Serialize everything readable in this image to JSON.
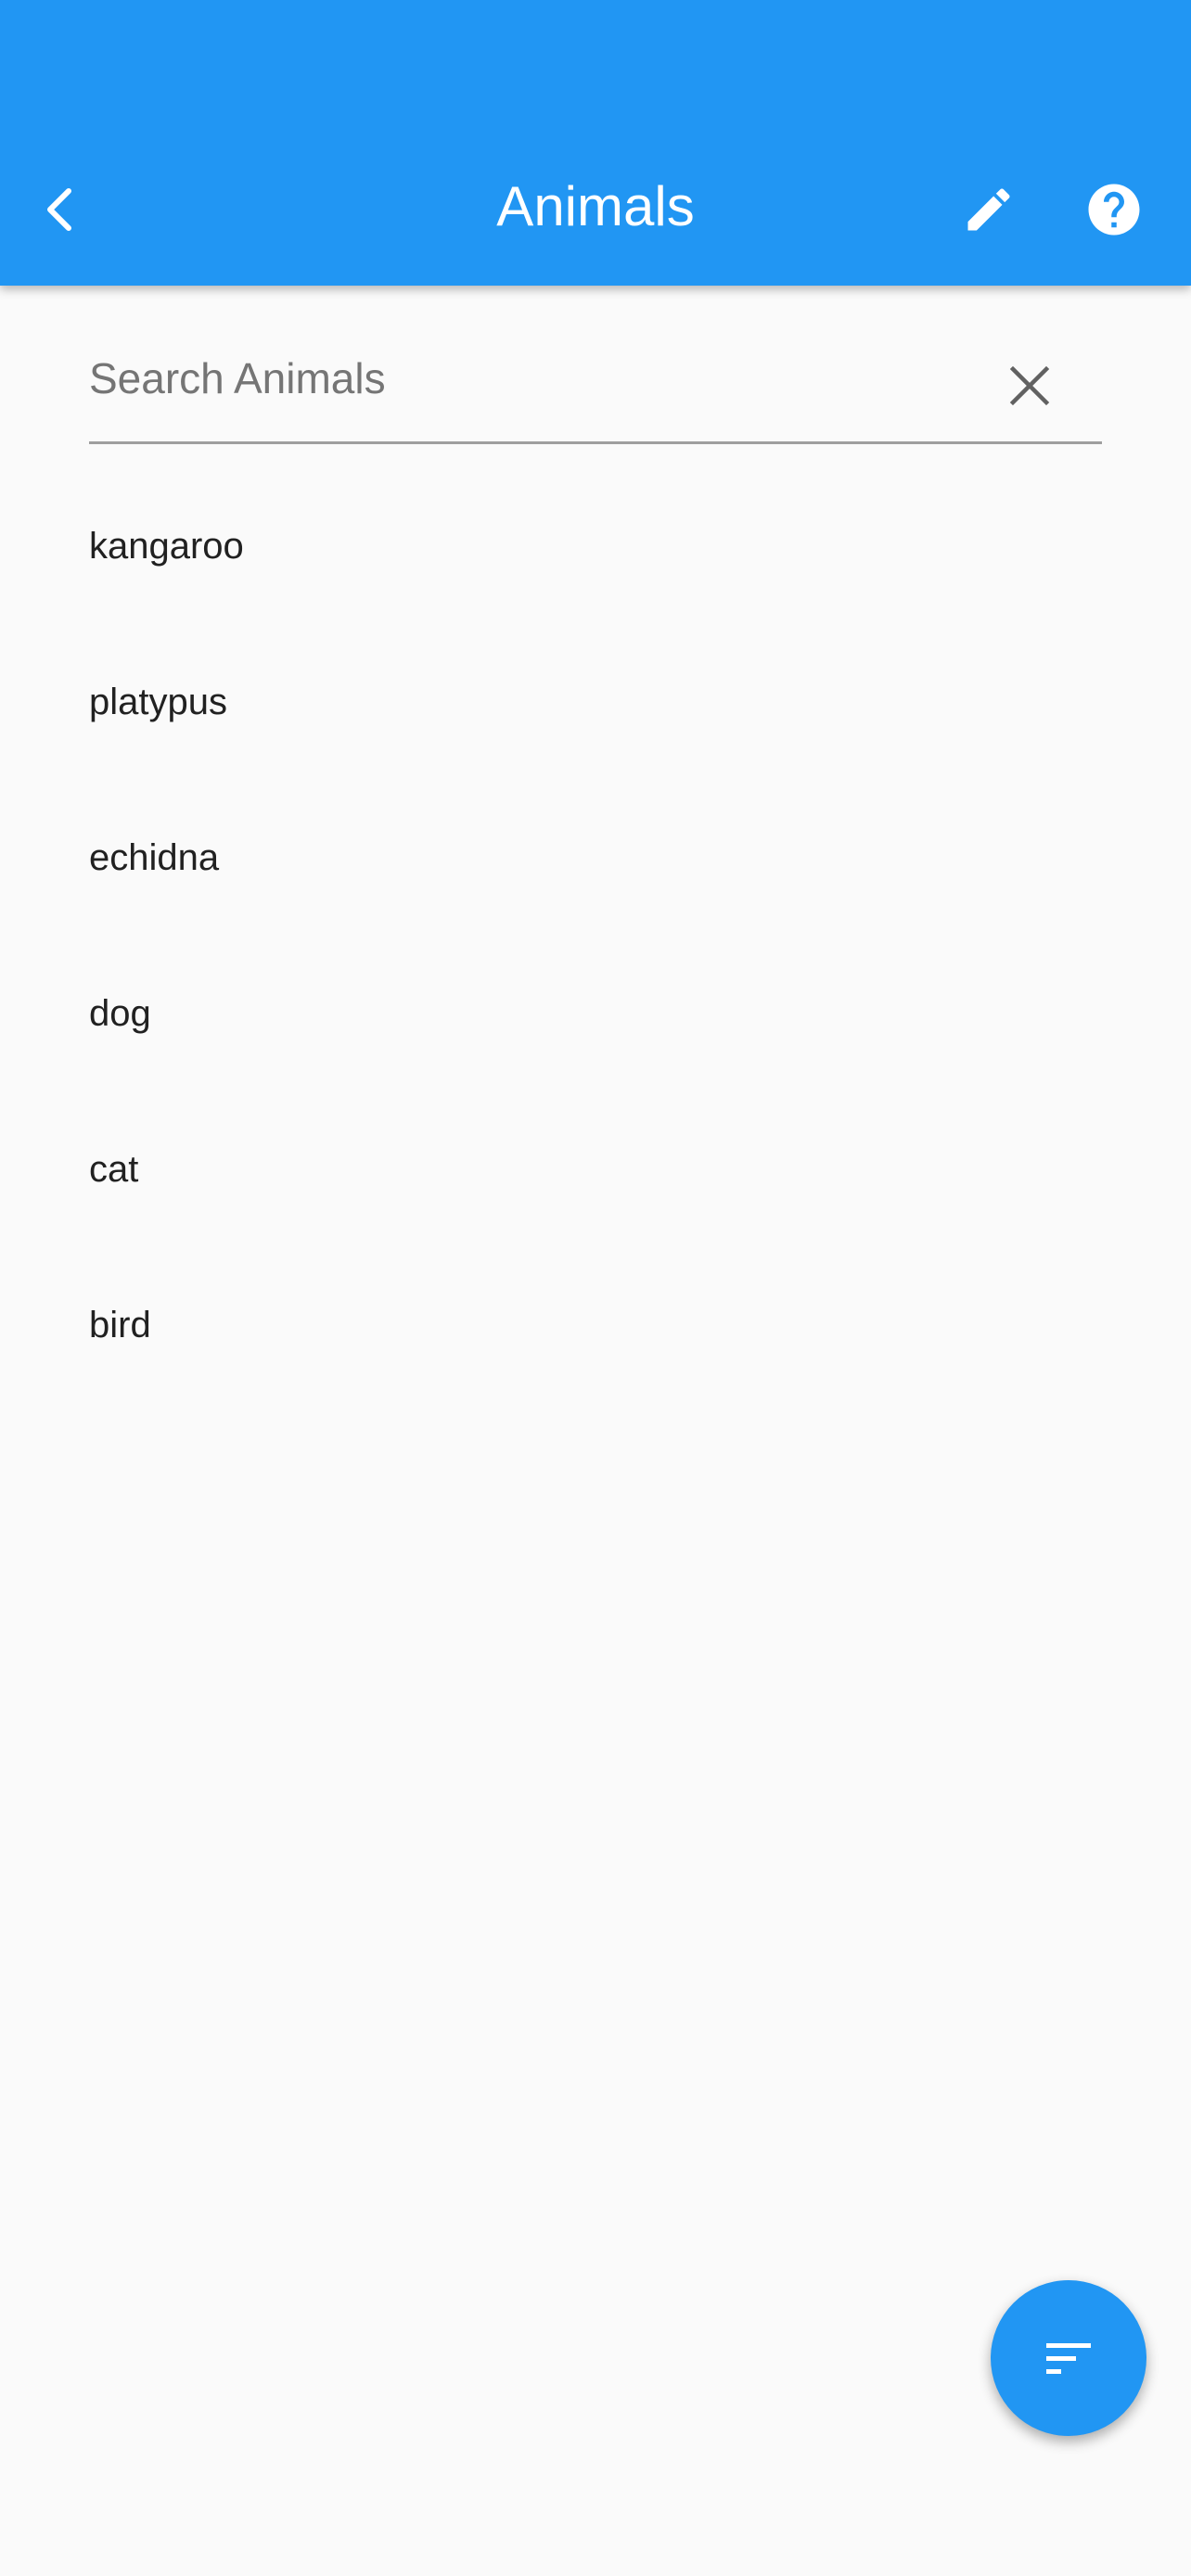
{
  "app_bar": {
    "title": "Animals",
    "back_icon": "chevron-left-icon",
    "edit_icon": "pencil-icon",
    "help_icon": "help-circle-icon",
    "color": "#2196f3"
  },
  "search": {
    "placeholder": "Search Animals",
    "value": "",
    "clear_icon": "close-icon"
  },
  "animals": [
    {
      "label": "kangaroo"
    },
    {
      "label": "platypus"
    },
    {
      "label": "echidna"
    },
    {
      "label": "dog"
    },
    {
      "label": "cat"
    },
    {
      "label": "bird"
    }
  ],
  "fab": {
    "icon": "sort-icon",
    "color": "#2196f3"
  }
}
